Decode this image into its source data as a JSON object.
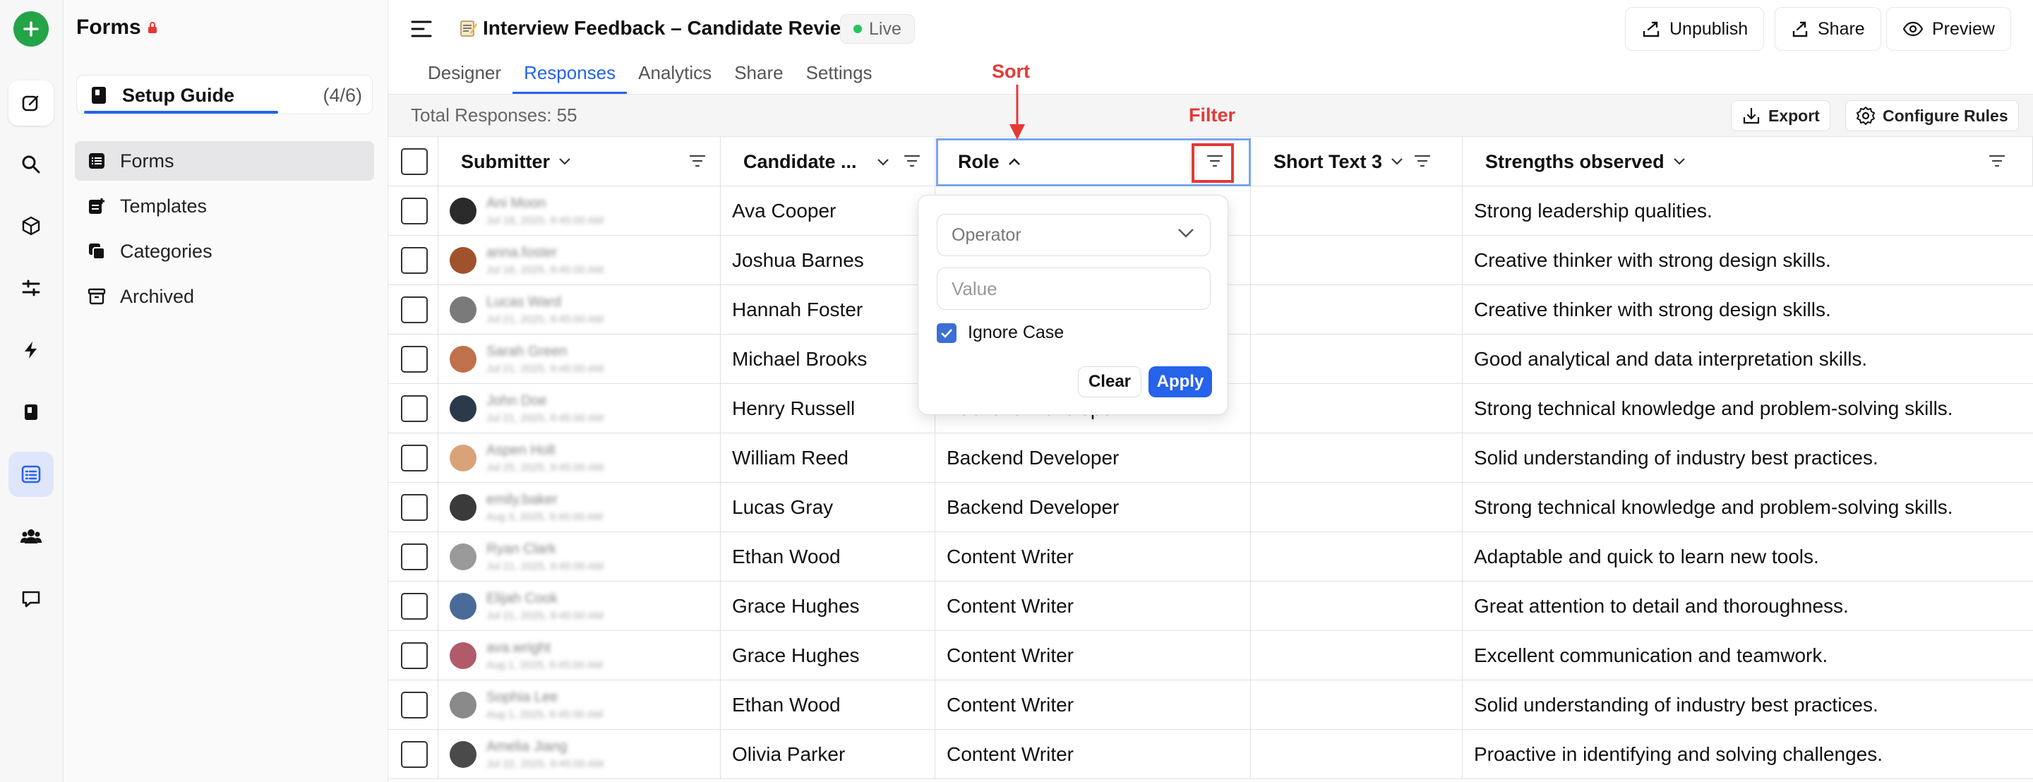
{
  "sidebar": {
    "title": "Forms",
    "setup_guide": {
      "label": "Setup Guide",
      "count": "(4/6)",
      "progress": 0.67
    },
    "items": [
      {
        "label": "Forms",
        "icon": "table-icon",
        "active": true
      },
      {
        "label": "Templates",
        "icon": "template-icon",
        "active": false
      },
      {
        "label": "Categories",
        "icon": "categories-icon",
        "active": false
      },
      {
        "label": "Archived",
        "icon": "archive-icon",
        "active": false
      }
    ]
  },
  "rail": {
    "icons": [
      "add-icon",
      "edit-icon",
      "search-icon",
      "cube-icon",
      "sliders-icon",
      "bolt-icon",
      "book-icon",
      "list-icon",
      "users-icon",
      "chat-icon"
    ]
  },
  "header": {
    "title": "Interview Feedback – Candidate Review",
    "status": "Live",
    "buttons": {
      "unpublish": "Unpublish",
      "share": "Share",
      "preview": "Preview"
    },
    "tabs": [
      "Designer",
      "Responses",
      "Analytics",
      "Share",
      "Settings"
    ],
    "active_tab": "Responses"
  },
  "toolbar": {
    "total": "Total Responses: 55",
    "export": "Export",
    "configure_rules": "Configure Rules"
  },
  "table": {
    "columns": [
      "Submitter",
      "Candidate ...",
      "Role",
      "Short Text 3",
      "Strengths observed"
    ],
    "rows": [
      {
        "submitter": "Ani Moon",
        "date": "Jul 18, 2025, 9:45:00 AM",
        "candidate": "Ava Cooper",
        "role": "",
        "short": "",
        "strength": "Strong leadership qualities."
      },
      {
        "submitter": "anna.foster",
        "date": "Jul 18, 2025, 9:45:00 AM",
        "candidate": "Joshua Barnes",
        "role": "",
        "short": "",
        "strength": "Creative thinker with strong design skills."
      },
      {
        "submitter": "Lucas Ward",
        "date": "Jul 21, 2025, 9:45:00 AM",
        "candidate": "Hannah Foster",
        "role": "",
        "short": "",
        "strength": "Creative thinker with strong design skills."
      },
      {
        "submitter": "Sarah Green",
        "date": "Jul 21, 2025, 9:45:00 AM",
        "candidate": "Michael Brooks",
        "role": "",
        "short": "",
        "strength": "Good analytical and data interpretation skills."
      },
      {
        "submitter": "John Doe",
        "date": "Jul 21, 2025, 9:45:00 AM",
        "candidate": "Henry Russell",
        "role": "Backend Developer",
        "short": "",
        "strength": "Strong technical knowledge and problem-solving skills."
      },
      {
        "submitter": "Aspen Holt",
        "date": "Jul 25, 2025, 9:45:00 AM",
        "candidate": "William Reed",
        "role": "Backend Developer",
        "short": "",
        "strength": "Solid understanding of industry best practices."
      },
      {
        "submitter": "emily.baker",
        "date": "Aug 3, 2025, 9:45:00 AM",
        "candidate": "Lucas Gray",
        "role": "Backend Developer",
        "short": "",
        "strength": "Strong technical knowledge and problem-solving skills."
      },
      {
        "submitter": "Ryan Clark",
        "date": "Jul 21, 2025, 9:45:00 AM",
        "candidate": "Ethan Wood",
        "role": "Content Writer",
        "short": "",
        "strength": "Adaptable and quick to learn new tools."
      },
      {
        "submitter": "Elijah Cook",
        "date": "Jul 21, 2025, 9:45:00 AM",
        "candidate": "Grace Hughes",
        "role": "Content Writer",
        "short": "",
        "strength": "Great attention to detail and thoroughness."
      },
      {
        "submitter": "ava.wright",
        "date": "Aug 1, 2025, 9:45:00 AM",
        "candidate": "Grace Hughes",
        "role": "Content Writer",
        "short": "",
        "strength": "Excellent communication and teamwork."
      },
      {
        "submitter": "Sophia Lee",
        "date": "Aug 1, 2025, 9:45:00 AM",
        "candidate": "Ethan Wood",
        "role": "Content Writer",
        "short": "",
        "strength": "Solid understanding of industry best practices."
      },
      {
        "submitter": "Amelia Jiang",
        "date": "Jul 22, 2025, 9:45:00 AM",
        "candidate": "Olivia Parker",
        "role": "Content Writer",
        "short": "",
        "strength": "Proactive in identifying and solving challenges."
      }
    ]
  },
  "filter_popup": {
    "operator_placeholder": "Operator",
    "value_placeholder": "Value",
    "ignore_case_label": "Ignore Case",
    "ignore_case_checked": true,
    "clear": "Clear",
    "apply": "Apply"
  },
  "annotations": {
    "sort": "Sort",
    "filter": "Filter"
  },
  "colors": {
    "accent": "#2563eb",
    "annotation": "#e53935",
    "live": "#22c55e",
    "logo": "#22a447"
  }
}
